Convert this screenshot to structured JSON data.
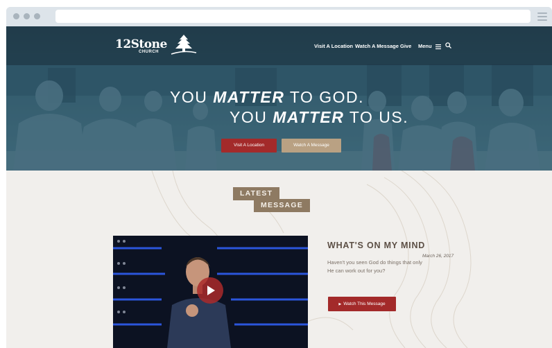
{
  "brand": {
    "logo_main": "12Stone",
    "logo_sub": "CHURCH"
  },
  "nav": {
    "items": [
      "Visit A Location",
      "Watch A Message",
      "Give",
      "Menu"
    ],
    "menu_icon": "hamburger-icon",
    "search_icon": "search-icon"
  },
  "hero": {
    "line1_pre": "YOU ",
    "line1_emph": "MATTER",
    "line1_post": " TO GOD.",
    "line2_pre": "YOU ",
    "line2_emph": "MATTER",
    "line2_post": " TO US.",
    "primary_button": "Visit A Location",
    "secondary_button": "Watch A Message"
  },
  "latest": {
    "tag_line1": "LATEST",
    "tag_line2": "MESSAGE",
    "title": "WHAT'S ON MY MIND",
    "date": "March 26, 2017",
    "description": "Haven't you seen God do things that only He can work out for you?",
    "watch_button": "Watch This Message",
    "play_icon": "play-icon"
  },
  "colors": {
    "accent_red": "#a32a2a",
    "accent_tan": "#b9a183",
    "tag_brown": "#8e7a62",
    "hero_teal": "#3f6676",
    "page_bg": "#f1efec"
  }
}
